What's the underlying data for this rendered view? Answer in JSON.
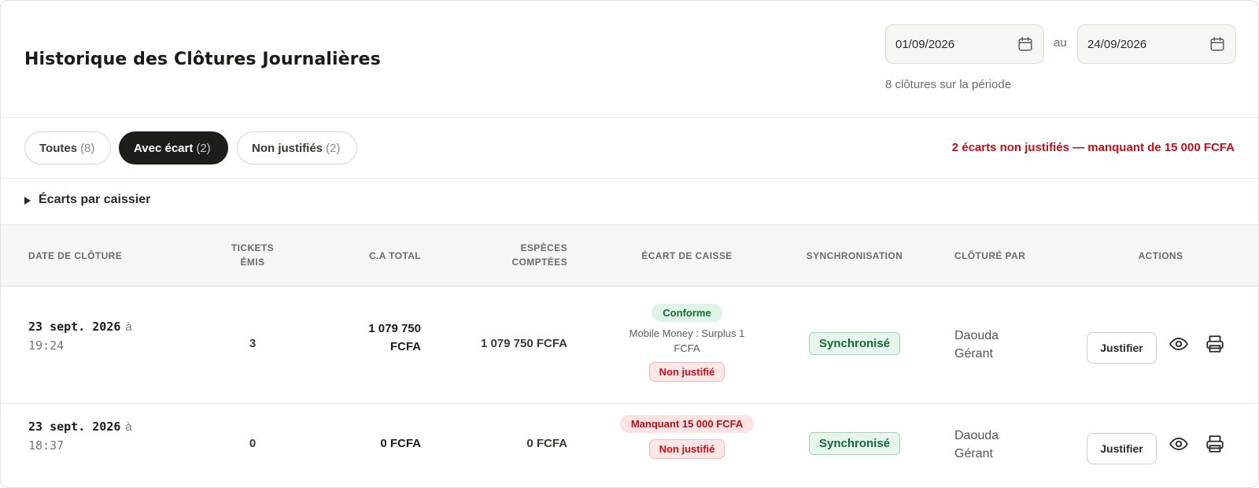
{
  "header": {
    "title": "Historique des Clôtures Journalières",
    "date_from": "01/09/2026",
    "date_to": "24/09/2026",
    "date_separator": "au",
    "period_count": "8 clôtures sur la période"
  },
  "filters": {
    "all": {
      "label": "Toutes",
      "count": "(8)"
    },
    "with_gap": {
      "label": "Avec écart",
      "count": "(2)"
    },
    "unjustified": {
      "label": "Non justifiés",
      "count": "(2)"
    },
    "alert": "2 écarts non justifiés — manquant de 15 000 FCFA"
  },
  "expander": {
    "label": "Écarts par caissier"
  },
  "table": {
    "columns": {
      "date": "Date de clôture",
      "tickets_l1": "Tickets",
      "tickets_l2": "émis",
      "ca": "C.A Total",
      "cash_l1": "Espèces",
      "cash_l2": "comptées",
      "gap": "Écart de caisse",
      "sync": "Synchronisation",
      "closed_by": "Clôturé par",
      "actions": "Actions"
    },
    "rows": [
      {
        "date": "23 sept. 2026",
        "a": "à",
        "time": "19:24",
        "tickets": "3",
        "ca_l1": "1 079 750",
        "ca_l2": "FCFA",
        "cash": "1 079 750 FCFA",
        "gap_badge": "Conforme",
        "gap_note_l1": "Mobile Money : Surplus 1",
        "gap_note_l2": "FCFA",
        "gap_status": "Non justifié",
        "sync": "Synchronisé",
        "closer_name": "Daouda",
        "closer_role": "Gérant",
        "action_label": "Justifier"
      },
      {
        "date": "23 sept. 2026",
        "a": "à",
        "time": "18:37",
        "tickets": "0",
        "ca": "0 FCFA",
        "cash": "0 FCFA",
        "gap_badge": "Manquant 15 000 FCFA",
        "gap_status": "Non justifié",
        "sync": "Synchronisé",
        "closer_name": "Daouda",
        "closer_role": "Gérant",
        "action_label": "Justifier"
      }
    ]
  },
  "icons": {
    "calendar": "calendar-icon",
    "view": "eye-icon",
    "print": "printer-icon"
  },
  "colors": {
    "accent_dark": "#1c1e18",
    "alert_red": "#c0101a",
    "success_green": "#136b34",
    "header_bg": "#f6f6f2"
  }
}
